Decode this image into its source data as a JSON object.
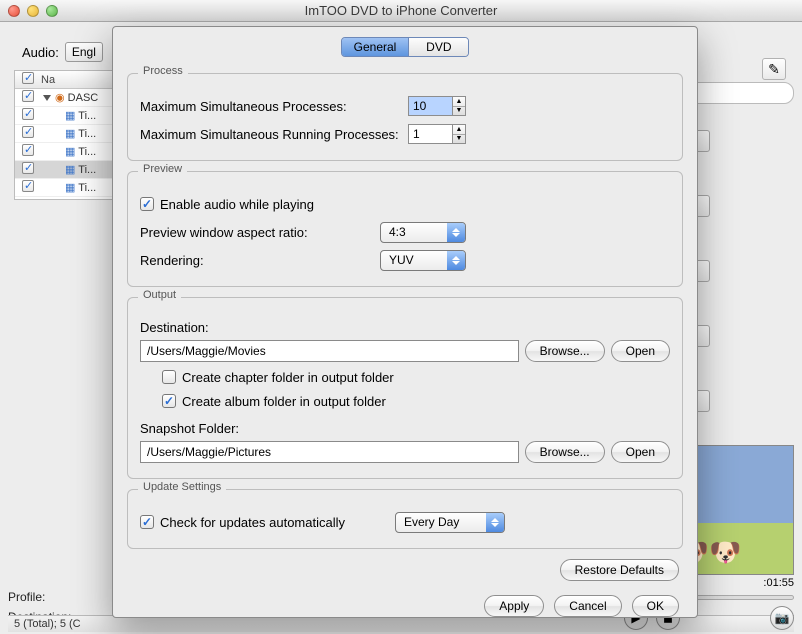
{
  "window": {
    "title": "ImTOO DVD to iPhone Converter"
  },
  "bg": {
    "audio_label": "Audio:",
    "audio_value": "Engl",
    "header_name": "Na",
    "rows": [
      {
        "checked": true,
        "label": "DASC",
        "root": true
      },
      {
        "checked": true,
        "label": "Ti..."
      },
      {
        "checked": true,
        "label": "Ti..."
      },
      {
        "checked": true,
        "label": "Ti..."
      },
      {
        "checked": true,
        "label": "Ti...",
        "selected": true
      },
      {
        "checked": true,
        "label": "Ti..."
      }
    ],
    "profile_label": "Profile:",
    "destination_label": "Destination:",
    "status": "5 (Total); 5 (C",
    "preview_time": ":01:55"
  },
  "tabs": {
    "general": "General",
    "dvd": "DVD",
    "active": "general"
  },
  "process": {
    "legend": "Process",
    "max_sim_label": "Maximum Simultaneous Processes:",
    "max_sim_value": "10",
    "max_run_label": "Maximum Simultaneous Running Processes:",
    "max_run_value": "1"
  },
  "preview": {
    "legend": "Preview",
    "enable_audio_label": "Enable audio while playing",
    "enable_audio_checked": true,
    "aspect_label": "Preview window aspect ratio:",
    "aspect_value": "4:3",
    "rendering_label": "Rendering:",
    "rendering_value": "YUV"
  },
  "output": {
    "legend": "Output",
    "dest_label": "Destination:",
    "dest_value": "/Users/Maggie/Movies",
    "browse": "Browse...",
    "open": "Open",
    "chapter_label": "Create chapter folder in output folder",
    "chapter_checked": false,
    "album_label": "Create album folder in output folder",
    "album_checked": true,
    "snapshot_label": "Snapshot Folder:",
    "snapshot_value": "/Users/Maggie/Pictures"
  },
  "update": {
    "legend": "Update Settings",
    "auto_label": "Check for updates automatically",
    "auto_checked": true,
    "freq_value": "Every Day"
  },
  "buttons": {
    "restore": "Restore Defaults",
    "apply": "Apply",
    "cancel": "Cancel",
    "ok": "OK"
  }
}
